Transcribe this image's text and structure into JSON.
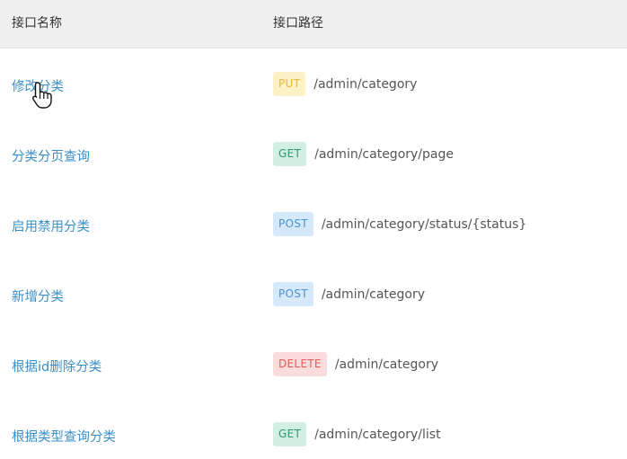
{
  "header": {
    "name_label": "接口名称",
    "path_label": "接口路径"
  },
  "rows": [
    {
      "name": "修改分类",
      "method": "PUT",
      "path": "/admin/category"
    },
    {
      "name": "分类分页查询",
      "method": "GET",
      "path": "/admin/category/page"
    },
    {
      "name": "启用禁用分类",
      "method": "POST",
      "path": "/admin/category/status/{status}"
    },
    {
      "name": "新增分类",
      "method": "POST",
      "path": "/admin/category"
    },
    {
      "name": "根据id删除分类",
      "method": "DELETE",
      "path": "/admin/category"
    },
    {
      "name": "根据类型查询分类",
      "method": "GET",
      "path": "/admin/category/list"
    }
  ],
  "colors": {
    "link": "#3a8fc8",
    "put_bg": "#fdf1c8",
    "put_fg": "#e6b73b",
    "get_bg": "#d3eee3",
    "get_fg": "#2d9a6d",
    "post_bg": "#d6e9fb",
    "post_fg": "#4b92cf",
    "delete_bg": "#fbdcdc",
    "delete_fg": "#e25b5b"
  },
  "cursor": {
    "icon": "hand-pointer-icon"
  }
}
